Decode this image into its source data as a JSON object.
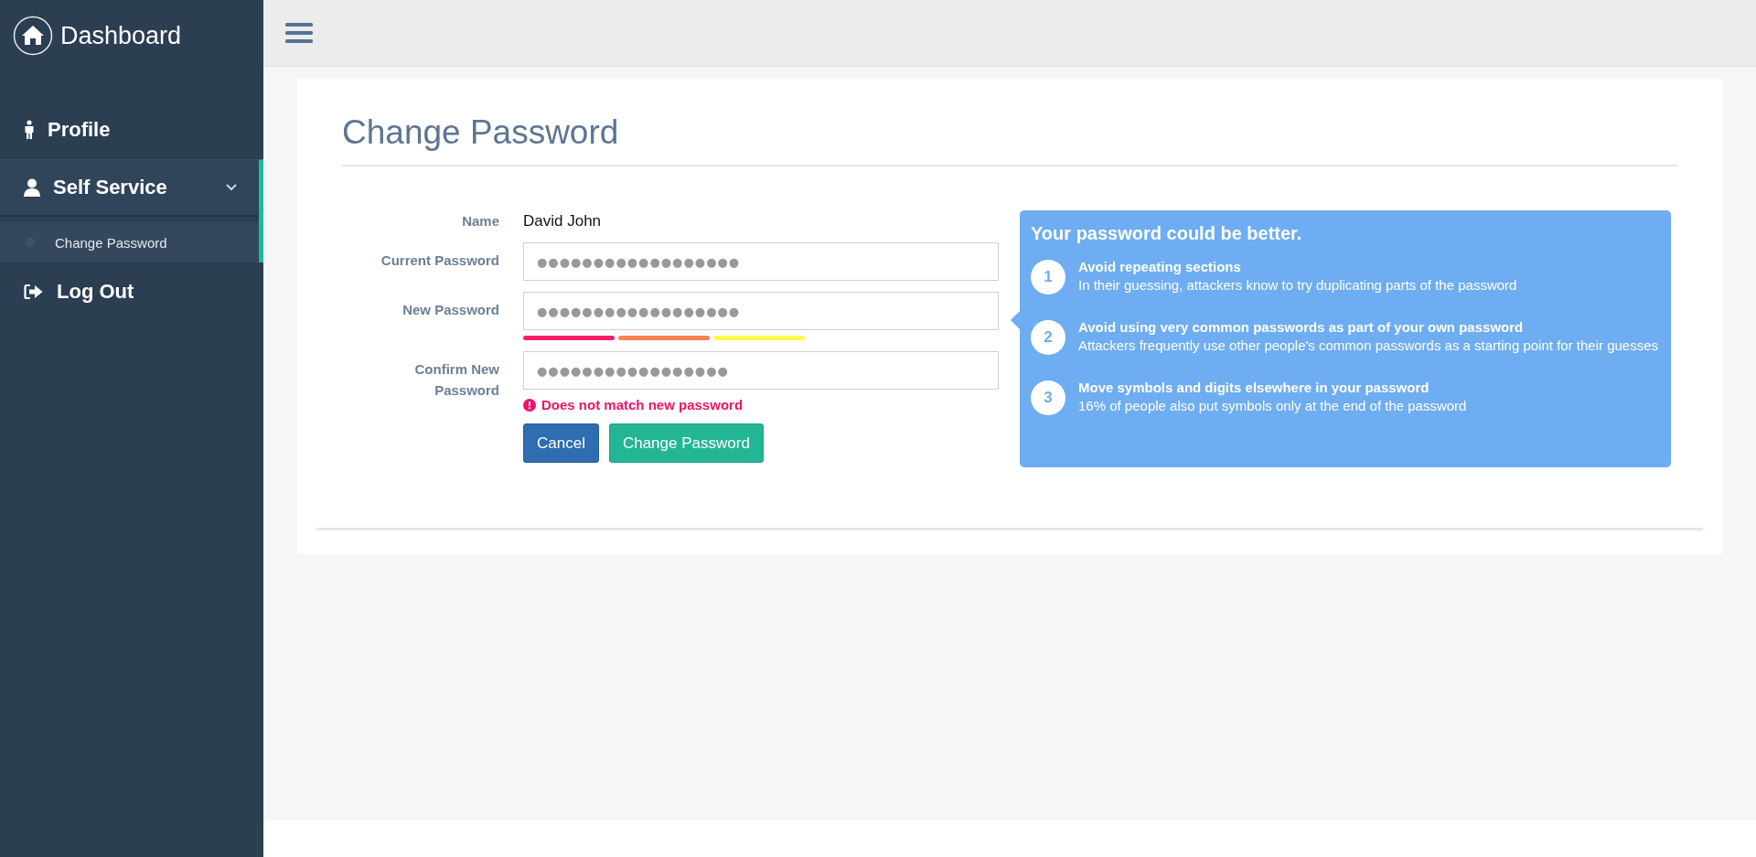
{
  "sidebar": {
    "brand": "Dashboard",
    "items": [
      {
        "label": "Profile",
        "kind": "person",
        "selected": false
      },
      {
        "label": "Self Service",
        "kind": "user",
        "selected": true,
        "expanded": true,
        "children": [
          {
            "label": "Change Password",
            "selected": true
          }
        ]
      },
      {
        "label": "Log Out",
        "kind": "logout",
        "selected": false
      }
    ]
  },
  "page": {
    "title": "Change Password",
    "form": {
      "name_label": "Name",
      "name_value": "David John",
      "fields": [
        {
          "label": "Current Password",
          "value": "●●●●●●●●●●●●●●●●●●"
        },
        {
          "label": "New Password",
          "value": "●●●●●●●●●●●●●●●●●●",
          "strength": [
            {
              "color": "#ff1a6e"
            },
            {
              "color": "#fd8159"
            },
            {
              "color": "#fdf94b"
            }
          ]
        },
        {
          "label": "Confirm New Password",
          "value": "●●●●●●●●●●●●●●●●●",
          "error": "Does not match new password"
        }
      ],
      "buttons": [
        {
          "label": "Cancel",
          "kind": "secondary"
        },
        {
          "label": "Change Password",
          "kind": "primary"
        }
      ]
    },
    "tips": {
      "title": "Your password could be better.",
      "items": [
        {
          "number": "1",
          "heading": "Avoid repeating sections",
          "text": "In their guessing, attackers know to try duplicating parts of the password"
        },
        {
          "number": "2",
          "heading": "Avoid using very common passwords as part of your own password",
          "text": "Attackers frequently use other people's common passwords as a starting point for their guesses"
        },
        {
          "number": "3",
          "heading": "Move symbols and digits elsewhere in your password",
          "text": "16% of people also put symbols only at the end of the password"
        }
      ]
    }
  }
}
